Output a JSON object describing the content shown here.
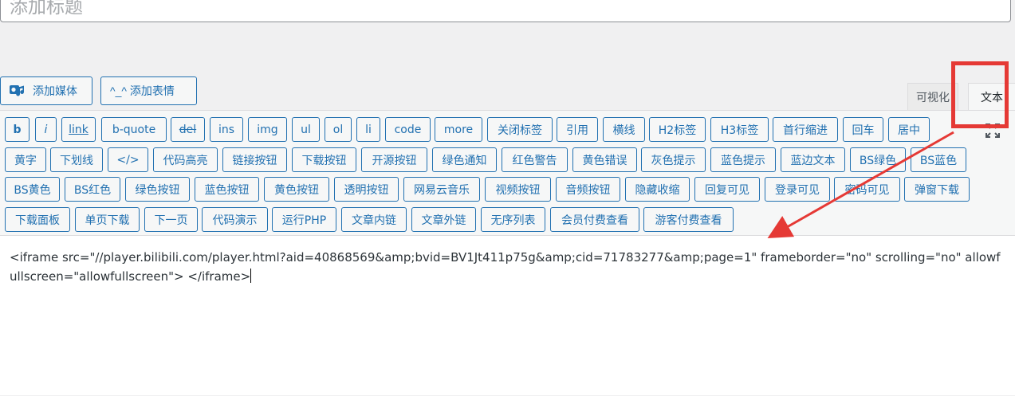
{
  "title": {
    "placeholder": "添加标题"
  },
  "media_buttons": {
    "add_media": "添加媒体",
    "add_emoji": "^_^ 添加表情"
  },
  "mode_tabs": {
    "visual": "可视化",
    "text": "文本"
  },
  "toolbar": {
    "row1": [
      "b",
      "i",
      "link",
      "b-quote",
      "del",
      "ins",
      "img",
      "ul",
      "ol",
      "li",
      "code",
      "more",
      "关闭标签",
      "引用",
      "横线",
      "H2标签",
      "H3标签",
      "首行缩进",
      "回车",
      "居中"
    ],
    "row2": [
      "黄字",
      "下划线",
      "</>",
      "代码高亮",
      "链接按钮",
      "下载按钮",
      "开源按钮",
      "绿色通知",
      "红色警告",
      "黄色错误",
      "灰色提示",
      "蓝色提示",
      "蓝边文本",
      "BS绿色",
      "BS蓝色"
    ],
    "row3": [
      "BS黄色",
      "BS红色",
      "绿色按钮",
      "蓝色按钮",
      "黄色按钮",
      "透明按钮",
      "网易云音乐",
      "视频按钮",
      "音频按钮",
      "隐藏收缩",
      "回复可见",
      "登录可见",
      "密码可见",
      "弹窗下载"
    ],
    "row4": [
      "下载面板",
      "单页下载",
      "下一页",
      "代码演示",
      "运行PHP",
      "文章内链",
      "文章外链",
      "无序列表",
      "会员付费查看",
      "游客付费查看"
    ]
  },
  "content": {
    "text": "<iframe src=\"//player.bilibili.com/player.html?aid=40868569&amp;bvid=BV1Jt411p75g&amp;cid=71783277&amp;page=1\" frameborder=\"no\" scrolling=\"no\" allowfullscreen=\"allowfullscreen\"> </iframe>"
  },
  "colors": {
    "accent": "#2271b1",
    "annotation": "#e53935"
  },
  "icons": {
    "media": "media-icon",
    "fullscreen": "fullscreen-icon"
  }
}
